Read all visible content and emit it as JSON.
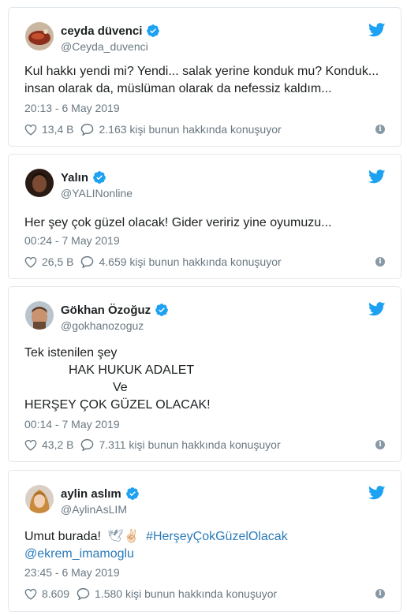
{
  "colors": {
    "accent": "#1da1f2",
    "link": "#2b7bb9",
    "muted": "#697882",
    "border": "#e1e8ed"
  },
  "icons": {
    "verified": "verified-badge-icon",
    "bird": "twitter-bird-icon",
    "like": "heart-icon",
    "reply": "comment-bubble-icon",
    "info": "info-icon"
  },
  "tweets": [
    {
      "name": "ceyda düvenci",
      "handle": "@Ceyda_duvenci",
      "lines": [
        "Kul hakkı yendi mi? Yendi... salak yerine konduk mu? Konduk...",
        "insan olarak da, müslüman olarak da nefessiz kaldım..."
      ],
      "time": "20:13 - 6 May 2019",
      "likes": "13,4 B",
      "talk": "2.163 kişi bunun hakkında konuşuyor"
    },
    {
      "name": "Yalın",
      "handle": "@YALINonline",
      "lines": [
        "Her şey çok güzel olacak! Gider veririz yine oyumuzu..."
      ],
      "time": "00:24 - 7 May 2019",
      "likes": "26,5 B",
      "talk": "4.659 kişi bunun hakkında konuşuyor"
    },
    {
      "name": "Gökhan Özoğuz",
      "handle": "@gokhanozoguz",
      "lines": [
        "Tek istenilen şey",
        "HAK HUKUK ADALET",
        "Ve",
        "HERŞEY ÇOK GÜZEL OLACAK!"
      ],
      "time": "00:14 - 7 May 2019",
      "likes": "43,2 B",
      "talk": "7.311 kişi bunun hakkında konuşuyor"
    },
    {
      "name": "aylin aslım",
      "handle": "@AylinAsLIM",
      "lines": [
        "Umut burada!",
        "#HerşeyÇokGüzelOlacak",
        "@ekrem_imamoglu"
      ],
      "emoji": "🕊✌🏻",
      "time": "23:45 - 6 May 2019",
      "likes": "8.609",
      "talk": "1.580 kişi bunun hakkında konuşuyor"
    }
  ]
}
